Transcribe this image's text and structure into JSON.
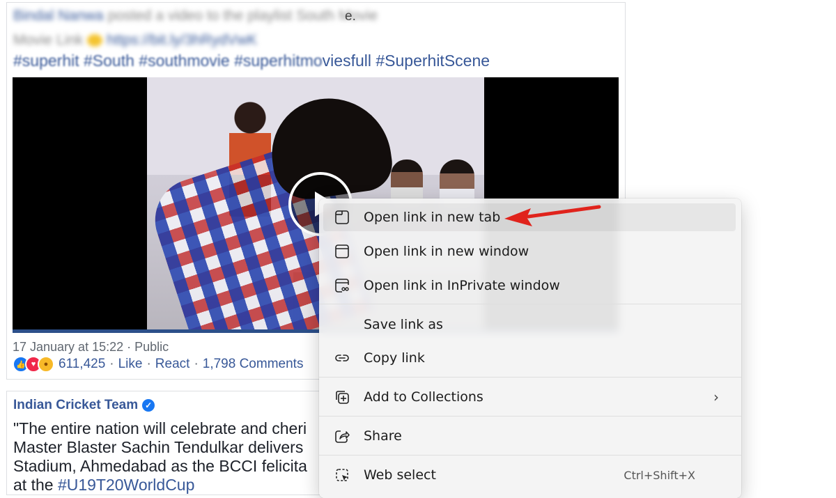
{
  "post1": {
    "header_blur_name": "Bindal Nanwa",
    "header_blur_text": "posted a video to the playlist South Movie",
    "header_tail": "e.",
    "blur_line2_text": "Movie Link",
    "blur_line2_link": "https://bit.ly/3hRydVwK",
    "hashtags_obscured": "#superhit #South #southmovie #superhitmo",
    "hashtags_visible": "viesfull #SuperhitScene",
    "timestamp": "17 January at 15:22",
    "visibility": "Public",
    "reaction_count": "611,425",
    "like_label": "Like",
    "react_label": "React",
    "comments_label": "1,798 Comments",
    "separator": "·"
  },
  "post2": {
    "author": "Indian Cricket Team",
    "text_lines": [
      "\"The entire nation will celebrate and cheri",
      "Master Blaster Sachin Tendulkar delivers",
      "Stadium, Ahmedabad as the BCCI felicita"
    ],
    "last_line_prefix": "at the ",
    "last_line_link": "#U19T20WorldCup"
  },
  "context_menu": {
    "items": [
      {
        "label": "Open link in new tab",
        "icon": "tab-icon"
      },
      {
        "label": "Open link in new window",
        "icon": "window-icon"
      },
      {
        "label": "Open link in InPrivate window",
        "icon": "inprivate-icon"
      },
      {
        "label": "Save link as",
        "icon": ""
      },
      {
        "label": "Copy link",
        "icon": "link-icon"
      },
      {
        "label": "Add to Collections",
        "icon": "collections-icon"
      },
      {
        "label": "Share",
        "icon": "share-icon"
      },
      {
        "label": "Web select",
        "icon": "web-select-icon",
        "shortcut": "Ctrl+Shift+X"
      }
    ],
    "chevron": "›"
  },
  "colors": {
    "link_blue": "#385898",
    "annotation_arrow": "#e0231c",
    "menu_bg": "#f3f3f3"
  }
}
